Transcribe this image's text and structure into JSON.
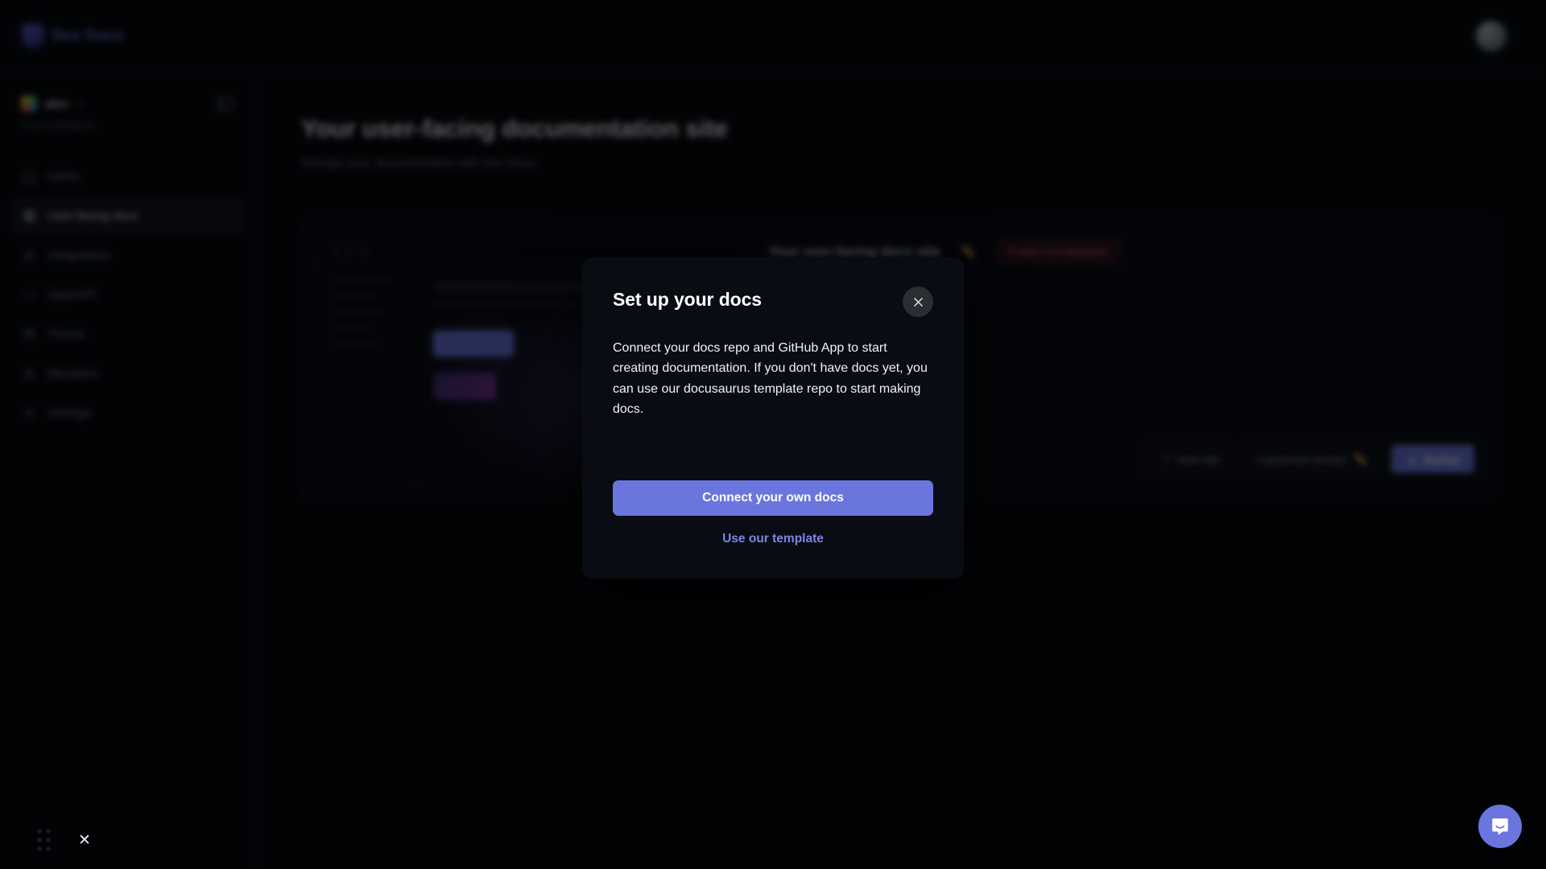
{
  "app": {
    "brand_name": "Dev Docs",
    "brand_icon": "shield-logo-icon"
  },
  "topbar": {
    "avatar_label": "",
    "avatar_icon": "user-avatar"
  },
  "sidebar": {
    "workspace": {
      "name": "alex",
      "plan_label": "Free workspace",
      "chevron": "▾",
      "collapse_icon": "panel-collapse-icon"
    },
    "items": [
      {
        "label": "Home",
        "icon": "home-icon",
        "active": false
      },
      {
        "label": "User-facing docs",
        "icon": "book-icon",
        "active": true
      },
      {
        "label": "Integrations",
        "icon": "plug-icon",
        "active": false
      },
      {
        "label": "OpenAPI",
        "icon": "code-icon",
        "active": false
      },
      {
        "label": "Theme",
        "icon": "palette-icon",
        "active": false
      },
      {
        "label": "Members",
        "icon": "users-icon",
        "active": false
      },
      {
        "label": "Settings",
        "icon": "gear-icon",
        "active": false
      }
    ]
  },
  "main": {
    "page_title": "Your user-facing documentation site",
    "page_subtitle": "Manage your documentation with Dev Docs",
    "card": {
      "site_label": "Your user-facing docs site",
      "edit_icon": "pencil-icon",
      "status_badge": "Project not deployed",
      "view_site_button": "View site",
      "domain_button": "Customize domain",
      "domain_icon": "pencil-icon",
      "deploy_button": "Deploy",
      "deploy_icon": "rocket-icon"
    }
  },
  "modal": {
    "title": "Set up your docs",
    "body": "Connect your docs repo and GitHub App to start creating documentation. If you don't have docs yet, you can use our docusaurus template repo to start making docs.",
    "primary_button": "Connect your own docs",
    "secondary_link": "Use our template",
    "close_icon": "close-icon"
  },
  "floating": {
    "grip_icon": "drag-grip-icon",
    "dismiss_icon": "close-icon",
    "dismiss_glyph": "✕",
    "chat_icon": "intercom-chat-icon"
  },
  "colors": {
    "accent": "#6b75de",
    "link": "#7b85e6",
    "danger": "#e0616f",
    "modal_bg": "#0a0c13",
    "app_bg": "#030406"
  }
}
